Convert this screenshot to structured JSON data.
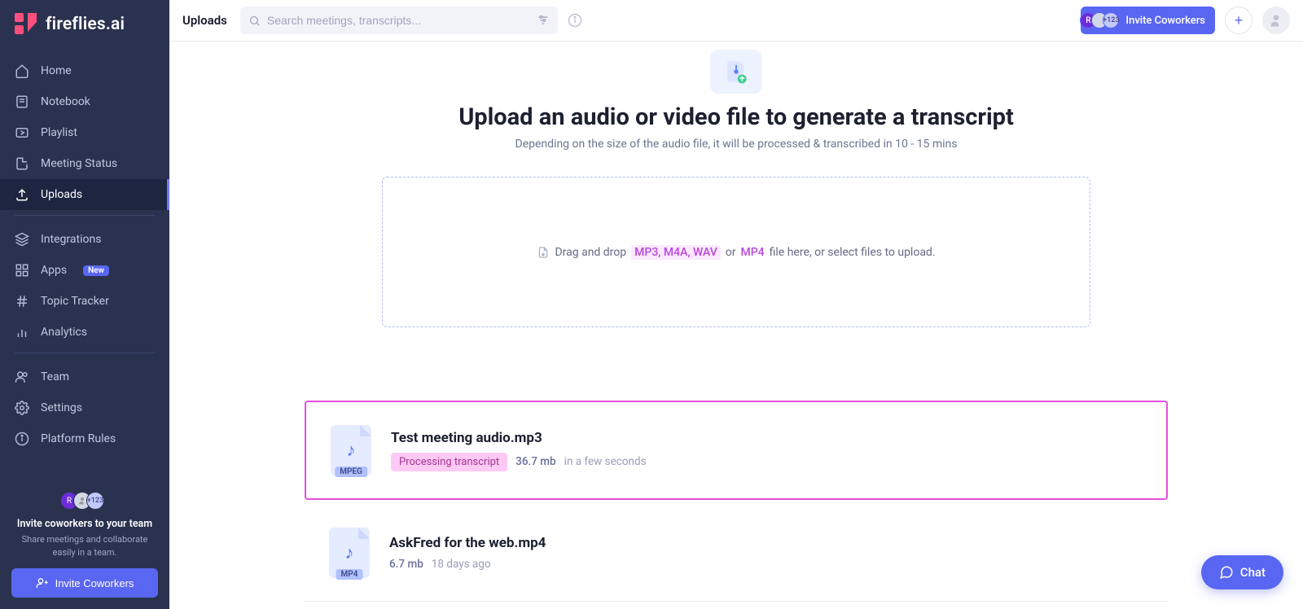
{
  "app_name": "fireflies.ai",
  "page_title": "Uploads",
  "search_placeholder": "Search meetings, transcripts...",
  "invite_label": "Invite Coworkers",
  "avatar_stack": {
    "letter": "R",
    "extra": "+123"
  },
  "sidebar": {
    "items": [
      {
        "label": "Home"
      },
      {
        "label": "Notebook"
      },
      {
        "label": "Playlist"
      },
      {
        "label": "Meeting Status"
      },
      {
        "label": "Uploads",
        "active": true
      }
    ],
    "group2": [
      {
        "label": "Integrations"
      },
      {
        "label": "Apps",
        "badge": "New"
      },
      {
        "label": "Topic Tracker"
      },
      {
        "label": "Analytics"
      }
    ],
    "group3": [
      {
        "label": "Team"
      },
      {
        "label": "Settings"
      },
      {
        "label": "Platform Rules"
      }
    ],
    "footer": {
      "title": "Invite coworkers to your team",
      "subtitle": "Share meetings and collaborate easily in a team.",
      "button": "Invite Coworkers"
    }
  },
  "hero": {
    "title": "Upload an audio or video file to generate a transcript",
    "subtitle": "Depending on the size of the audio file, it will be processed & transcribed in 10 - 15 mins"
  },
  "dropzone": {
    "prefix": "Drag and drop",
    "fmts1": "MP3, M4A, WAV",
    "or": "or",
    "fmts2": "MP4",
    "suffix": "file here, or select files to upload."
  },
  "uploads": [
    {
      "name": "Test meeting audio.mp3",
      "ext": "MPEG",
      "status": "Processing transcript",
      "size": "36.7 mb",
      "time": "in a few seconds",
      "highlight": true
    },
    {
      "name": "AskFred for the web.mp4",
      "ext": "MP4",
      "size": "6.7 mb",
      "time": "18 days ago",
      "highlight": false
    }
  ],
  "chat_label": "Chat"
}
